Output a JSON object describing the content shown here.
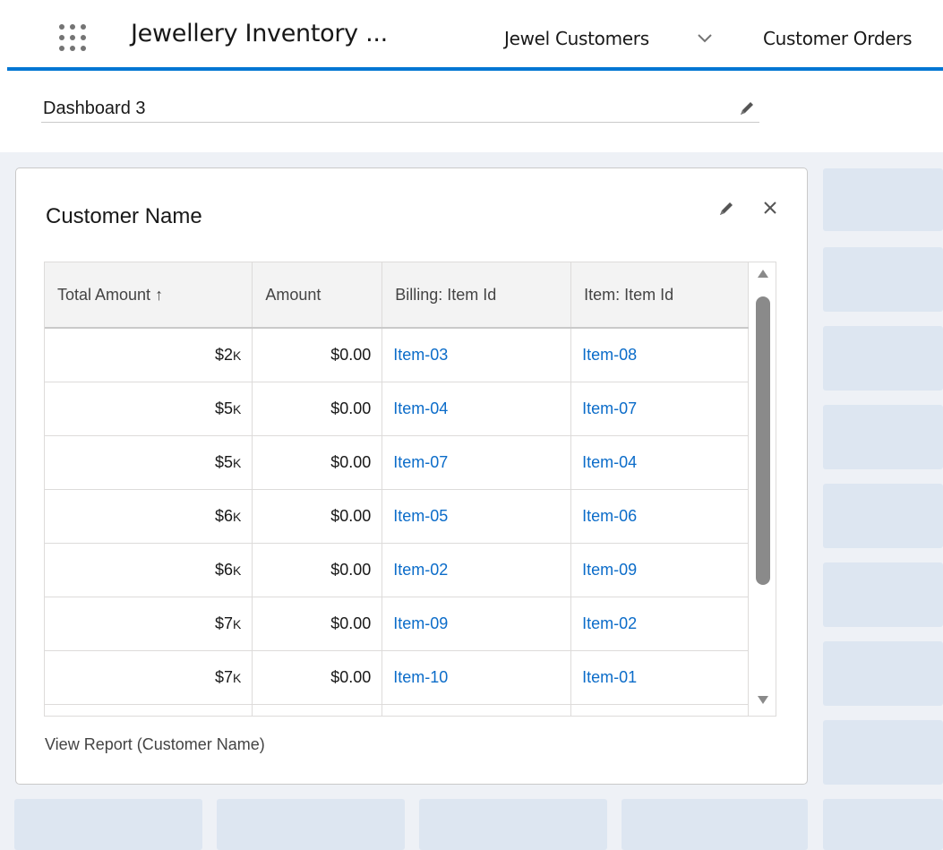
{
  "header": {
    "app_title": "Jewellery Inventory ...",
    "nav": [
      {
        "label": "Jewel Customers",
        "has_dropdown": true
      },
      {
        "label": "Customer Orders",
        "has_dropdown": false
      }
    ],
    "accent_color": "#0176d3"
  },
  "dashboard": {
    "title": "Dashboard 3"
  },
  "widget": {
    "title": "Customer Name",
    "columns": [
      "Total Amount ↑",
      "Amount",
      "Billing: Item Id",
      "Item: Item Id"
    ],
    "rows": [
      {
        "total": "$2",
        "total_unit": "K",
        "amount": "$0.00",
        "billing_item": "Item-03",
        "item": "Item-08"
      },
      {
        "total": "$5",
        "total_unit": "K",
        "amount": "$0.00",
        "billing_item": "Item-04",
        "item": "Item-07"
      },
      {
        "total": "$5",
        "total_unit": "K",
        "amount": "$0.00",
        "billing_item": "Item-07",
        "item": "Item-04"
      },
      {
        "total": "$6",
        "total_unit": "K",
        "amount": "$0.00",
        "billing_item": "Item-05",
        "item": "Item-06"
      },
      {
        "total": "$6",
        "total_unit": "K",
        "amount": "$0.00",
        "billing_item": "Item-02",
        "item": "Item-09"
      },
      {
        "total": "$7",
        "total_unit": "K",
        "amount": "$0.00",
        "billing_item": "Item-09",
        "item": "Item-02"
      },
      {
        "total": "$7",
        "total_unit": "K",
        "amount": "$0.00",
        "billing_item": "Item-10",
        "item": "Item-01"
      }
    ],
    "footer_link": "View Report (Customer Name)",
    "link_color": "#0b6cc9"
  },
  "icons": {
    "app_launcher": "waffle-icon",
    "edit": "pencil-icon",
    "close": "close-icon",
    "dropdown": "chevron-down-icon"
  }
}
